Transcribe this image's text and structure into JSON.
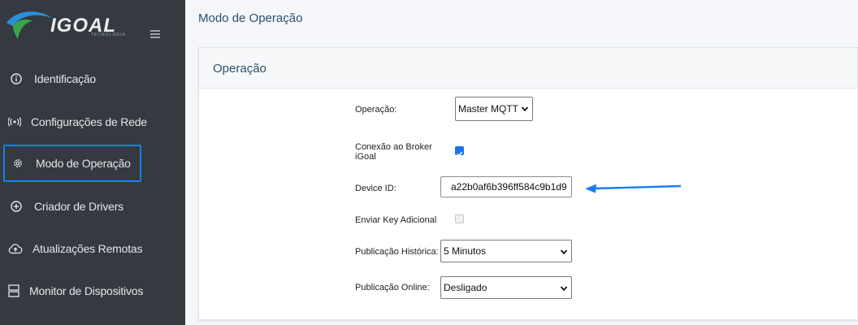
{
  "brand": {
    "name": "IGOAL",
    "tagline": "TECNOLOGIA"
  },
  "header": {
    "title": "Modo de Operação"
  },
  "sidebar": {
    "items": [
      {
        "label": "Identificação",
        "icon": "info-icon"
      },
      {
        "label": "Configurações de Rede",
        "icon": "wifi-broadcast-icon"
      },
      {
        "label": "Modo de Operação",
        "icon": "gear-icon",
        "active": true
      },
      {
        "label": "Criador de Drivers",
        "icon": "plus-circle-icon"
      },
      {
        "label": "Atualizações Remotas",
        "icon": "cloud-upload-icon"
      },
      {
        "label": "Monitor de Dispositivos",
        "icon": "server-icon"
      }
    ]
  },
  "card": {
    "title": "Operação"
  },
  "form": {
    "operacao": {
      "label": "Operação:",
      "value": "Master MQTT"
    },
    "conexao_broker": {
      "label": "Conexão ao Broker iGoal",
      "checked": true
    },
    "device_id": {
      "label": "Device ID:",
      "value": "a22b0af6b396ff584c9b1d9"
    },
    "enviar_key": {
      "label": "Enviar Key Adicional",
      "checked": false,
      "disabled": true
    },
    "publicacao_historica": {
      "label": "Publicação Histórica:",
      "value": "5 Minutos"
    },
    "publicacao_online": {
      "label": "Publicação Online:",
      "value": "Desligado"
    }
  },
  "colors": {
    "sidebar_bg": "#343a40",
    "active_border": "#1a7ef0",
    "arrow": "#1a7ef0",
    "title": "#2f4f6f"
  }
}
